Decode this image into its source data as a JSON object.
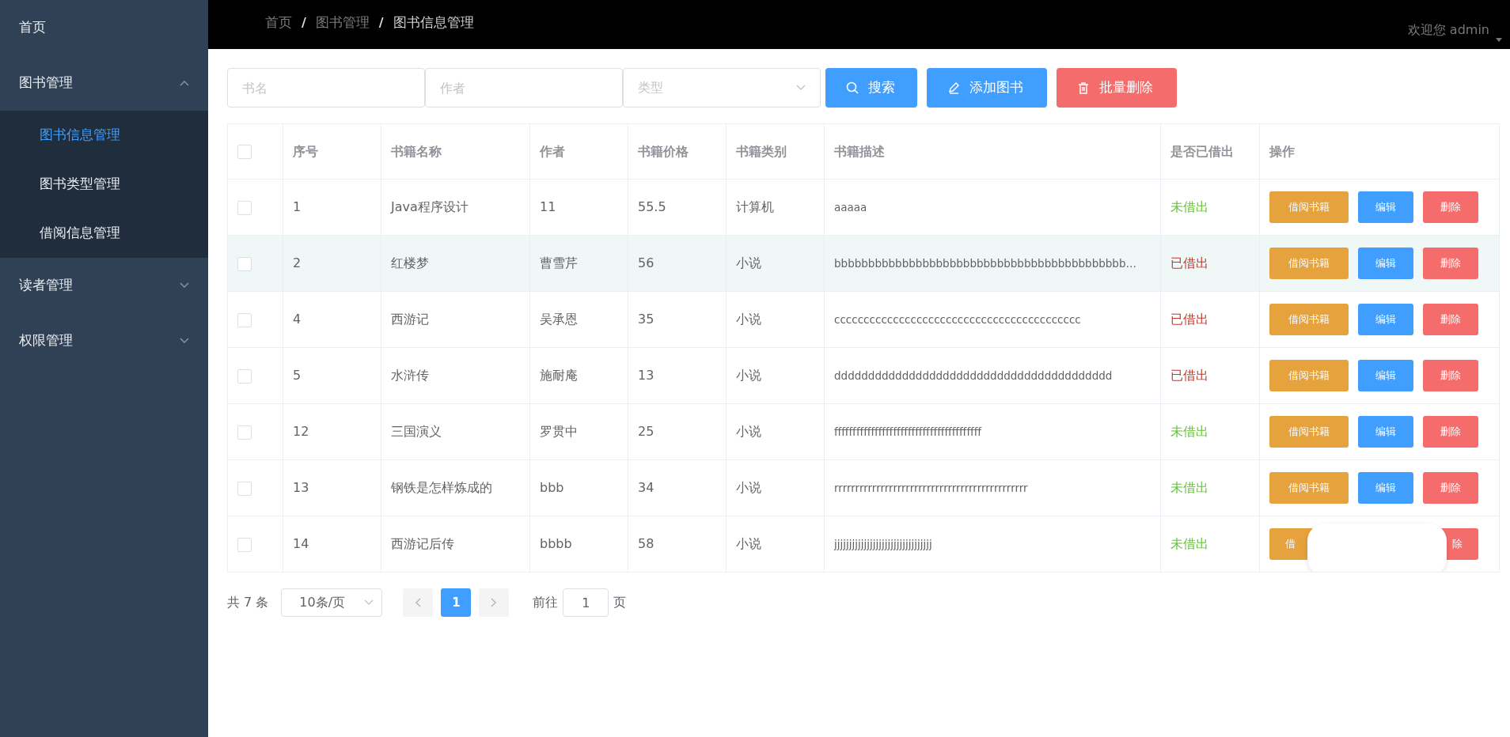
{
  "sidebar": {
    "items": [
      {
        "label": "首页"
      },
      {
        "label": "图书管理",
        "expanded": true,
        "children": [
          {
            "label": "图书信息管理",
            "selected": true
          },
          {
            "label": "图书类型管理",
            "selected": false
          },
          {
            "label": "借阅信息管理",
            "selected": false
          }
        ]
      },
      {
        "label": "读者管理",
        "expanded": false
      },
      {
        "label": "权限管理",
        "expanded": false
      }
    ]
  },
  "header": {
    "breadcrumbs": [
      {
        "label": "首页",
        "current": false
      },
      {
        "label": "图书管理",
        "current": false
      },
      {
        "label": "图书信息管理",
        "current": true
      }
    ],
    "separator": "/",
    "user": "欢迎您 admin"
  },
  "filters": {
    "name": {
      "placeholder": "书名"
    },
    "author": {
      "placeholder": "作者"
    },
    "type": {
      "placeholder": "类型"
    },
    "buttons": [
      {
        "kind": "search",
        "label": "搜索"
      },
      {
        "kind": "add",
        "label": "添加图书"
      },
      {
        "kind": "batch_delete",
        "label": "批量删除"
      }
    ]
  },
  "table": {
    "select_all_checked": false,
    "columns": [
      "序号",
      "书籍名称",
      "作者",
      "书籍价格",
      "书籍类别",
      "书籍描述",
      "是否已借出",
      "操作"
    ],
    "rows": [
      {
        "checked": false,
        "highlighted": false,
        "id": "1",
        "name": "Java程序设计",
        "author": "11",
        "price": "55.5",
        "category": "计算机",
        "description": "aaaaa",
        "borrowed": false,
        "status": "未借出",
        "actions_covered": false,
        "actions": [
          {
            "kind": "borrow",
            "label": "借阅书籍"
          },
          {
            "kind": "edit",
            "label": "编辑"
          },
          {
            "kind": "delete",
            "label": "删除"
          }
        ]
      },
      {
        "checked": false,
        "highlighted": true,
        "id": "2",
        "name": "红楼梦",
        "author": "曹雪芹",
        "price": "56",
        "category": "小说",
        "description": "bbbbbbbbbbbbbbbbbbbbbbbbbbbbbbbbbbbbbbbbbbb…",
        "borrowed": true,
        "status": "已借出",
        "actions_covered": false,
        "actions": [
          {
            "kind": "borrow",
            "label": "借阅书籍"
          },
          {
            "kind": "edit",
            "label": "编辑"
          },
          {
            "kind": "delete",
            "label": "删除"
          }
        ]
      },
      {
        "checked": false,
        "highlighted": false,
        "id": "4",
        "name": "西游记",
        "author": "吴承恩",
        "price": "35",
        "category": "小说",
        "description": "cccccccccccccccccccccccccccccccccccccccccc",
        "borrowed": true,
        "status": "已借出",
        "actions_covered": false,
        "actions": [
          {
            "kind": "borrow",
            "label": "借阅书籍"
          },
          {
            "kind": "edit",
            "label": "编辑"
          },
          {
            "kind": "delete",
            "label": "删除"
          }
        ]
      },
      {
        "checked": false,
        "highlighted": false,
        "id": "5",
        "name": "水浒传",
        "author": "施耐庵",
        "price": "13",
        "category": "小说",
        "description": "ddddddddddddddddddddddddddddddddddddddddd",
        "borrowed": true,
        "status": "已借出",
        "actions_covered": false,
        "actions": [
          {
            "kind": "borrow",
            "label": "借阅书籍"
          },
          {
            "kind": "edit",
            "label": "编辑"
          },
          {
            "kind": "delete",
            "label": "删除"
          }
        ]
      },
      {
        "checked": false,
        "highlighted": false,
        "id": "12",
        "name": "三国演义",
        "author": "罗贯中",
        "price": "25",
        "category": "小说",
        "description": "ffffffffffffffffffffffffffffffffffffffff",
        "borrowed": false,
        "status": "未借出",
        "actions_covered": false,
        "actions": [
          {
            "kind": "borrow",
            "label": "借阅书籍"
          },
          {
            "kind": "edit",
            "label": "编辑"
          },
          {
            "kind": "delete",
            "label": "删除"
          }
        ]
      },
      {
        "checked": false,
        "highlighted": false,
        "id": "13",
        "name": "钢铁是怎样炼成的",
        "author": "bbb",
        "price": "34",
        "category": "小说",
        "description": "rrrrrrrrrrrrrrrrrrrrrrrrrrrrrrrrrrrrrrrrrrrrrr",
        "borrowed": false,
        "status": "未借出",
        "actions_covered": false,
        "actions": [
          {
            "kind": "borrow",
            "label": "借阅书籍"
          },
          {
            "kind": "edit",
            "label": "编辑"
          },
          {
            "kind": "delete",
            "label": "删除"
          }
        ]
      },
      {
        "checked": false,
        "highlighted": false,
        "id": "14",
        "name": "西游记后传",
        "author": "bbbb",
        "price": "58",
        "category": "小说",
        "description": "jjjjjjjjjjjjjjjjjjjjjjjjjjjjjjjjj",
        "borrowed": false,
        "status": "未借出",
        "actions_covered": true,
        "actions": [
          {
            "kind": "borrow",
            "label": "借"
          },
          {
            "kind": "delete",
            "label": "除"
          }
        ]
      }
    ]
  },
  "pagination": {
    "total": "共 7 条",
    "page_size": "10条/页",
    "pages": [
      {
        "label": "1",
        "selected": true
      }
    ],
    "goto_label": "前往",
    "goto_value": "1",
    "goto_suffix": "页"
  }
}
